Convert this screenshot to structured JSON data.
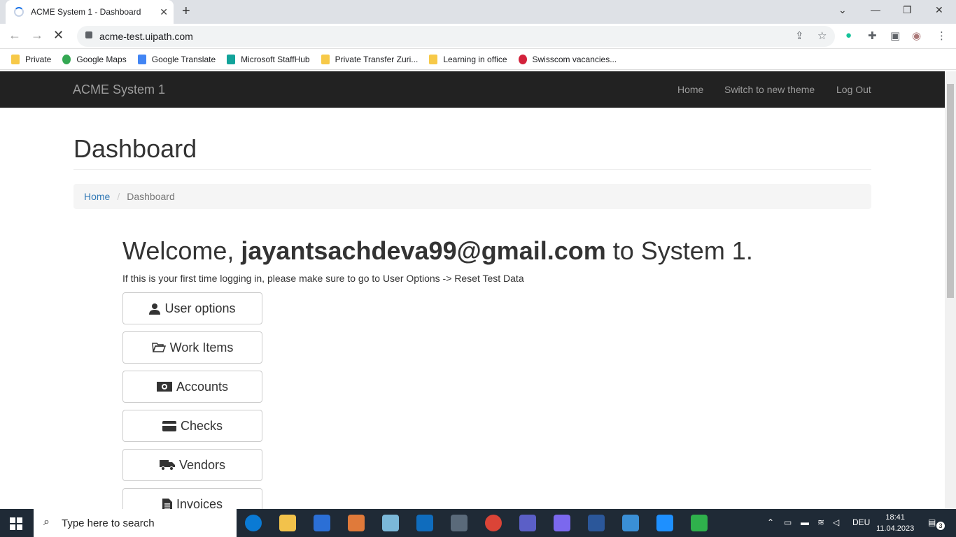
{
  "browser": {
    "tab_title": "ACME System 1 - Dashboard",
    "url": "acme-test.uipath.com",
    "bookmarks": [
      "Private",
      "Google Maps",
      "Google Translate",
      "Microsoft StaffHub",
      "Private Transfer Zuri...",
      "Learning in office",
      "Swisscom vacancies..."
    ]
  },
  "navbar": {
    "brand": "ACME System 1",
    "links": [
      "Home",
      "Switch to new theme",
      "Log Out"
    ]
  },
  "page": {
    "title": "Dashboard",
    "breadcrumb": {
      "home": "Home",
      "current": "Dashboard"
    },
    "welcome_prefix": "Welcome, ",
    "welcome_user": "jayantsachdeva99@gmail.com",
    "welcome_suffix": " to System 1.",
    "note": "If this is your first time logging in, please make sure to go to User Options -> Reset Test Data",
    "buttons": [
      "User options",
      "Work Items",
      "Accounts",
      "Checks",
      "Vendors",
      "Invoices"
    ]
  },
  "taskbar": {
    "search_placeholder": "Type here to search",
    "language": "DEU",
    "time": "18:41",
    "date": "11.04.2023",
    "notification_count": "3"
  }
}
